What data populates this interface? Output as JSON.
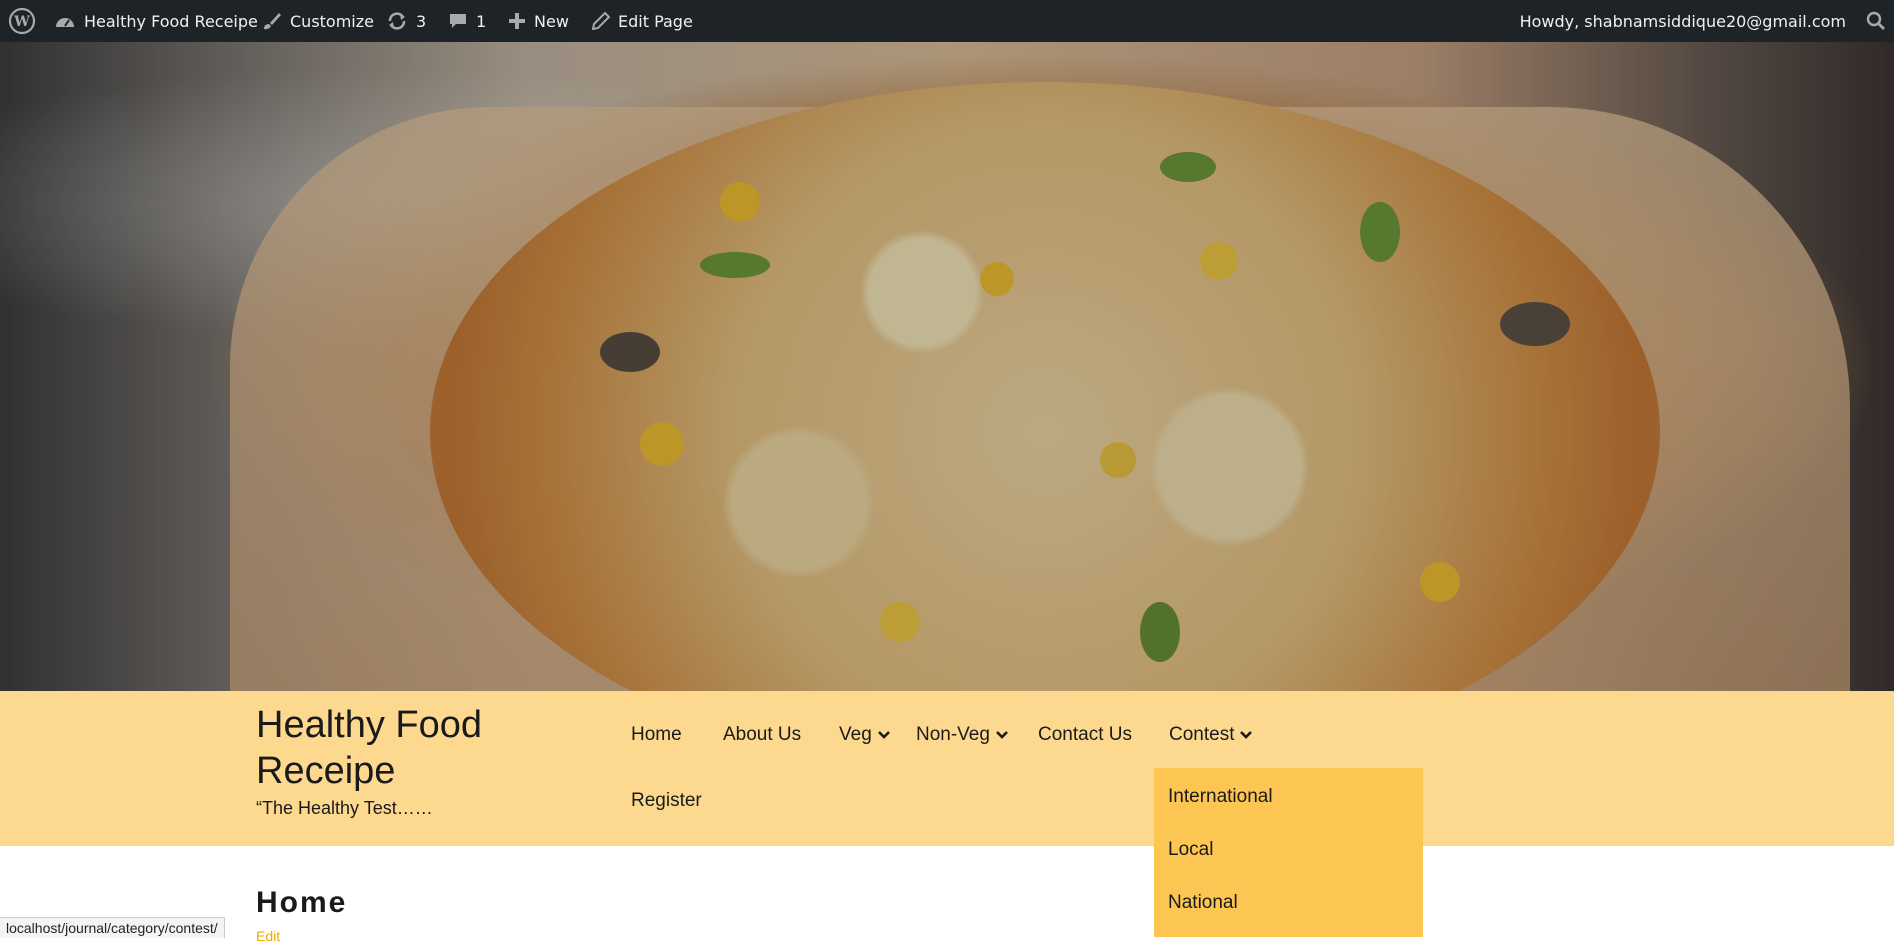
{
  "admin_bar": {
    "site_name": "Healthy Food Receipe",
    "customize_label": "Customize",
    "updates_count": "3",
    "comments_count": "1",
    "new_label": "New",
    "edit_page_label": "Edit Page",
    "howdy_label": "Howdy, shabnamsiddique20@gmail.com"
  },
  "site": {
    "title": "Healthy Food Receipe",
    "tagline": "“The Healthy Test……"
  },
  "nav": {
    "items": [
      "Home",
      "About Us",
      "Veg",
      "Non-Veg",
      "Contact Us",
      "Contest",
      "Register"
    ],
    "dropdown_items": [
      "International",
      "Local",
      "National"
    ]
  },
  "page": {
    "title": "Home",
    "edit_link": "Edit"
  },
  "status_bar": {
    "url": "localhost/journal/category/contest/"
  },
  "colors": {
    "admin_bar_bg": "#1d2327",
    "header_bg": "#fdd98f",
    "dropdown_bg": "#fdc652",
    "edit_link": "#f2a900"
  },
  "icons": [
    "wordpress-icon",
    "dashboard-icon",
    "brush-icon",
    "updates-icon",
    "comment-icon",
    "plus-icon",
    "pencil-icon",
    "search-icon",
    "chevron-down-icon"
  ]
}
